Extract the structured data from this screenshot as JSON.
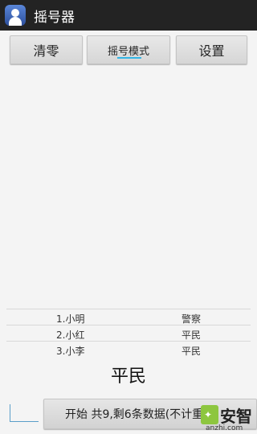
{
  "app": {
    "title": "摇号器",
    "icon": "app-person-icon"
  },
  "toolbar": {
    "clear_label": "清零",
    "mode_label": "摇号模式",
    "settings_label": "设置"
  },
  "list": [
    {
      "name": "1.小明",
      "role": "警察"
    },
    {
      "name": "2.小红",
      "role": "平民"
    },
    {
      "name": "3.小李",
      "role": "平民"
    }
  ],
  "result": "平民",
  "start_button": {
    "label": "开始  共9,剩6条数据(不计重)"
  },
  "watermark": {
    "text": "安智",
    "url": "anzhi.com"
  },
  "colors": {
    "titlebar": "#232323",
    "accent": "#33b5e5",
    "watermark_green": "#8dc63f"
  }
}
